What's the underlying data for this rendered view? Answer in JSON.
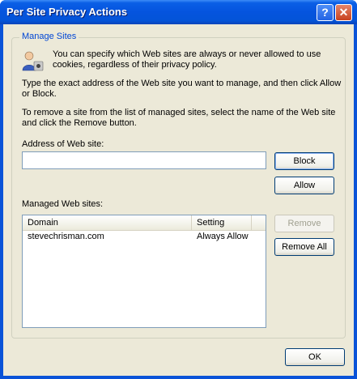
{
  "window": {
    "title": "Per Site Privacy Actions",
    "help_glyph": "?",
    "close_glyph": "✕"
  },
  "group": {
    "label": "Manage Sites"
  },
  "text": {
    "intro_line1": "You can specify which Web sites are always or never allowed to use",
    "intro_line2": "cookies, regardless of their privacy policy.",
    "type_line1": "Type the exact address of the Web site you want to manage, and then click Allow",
    "type_line2": "or Block.",
    "remove_line1": "To remove a site from the list of managed sites, select the name of the Web site",
    "remove_line2": "and click the Remove button.",
    "address_label": "Address of Web site:",
    "managed_label": "Managed Web sites:"
  },
  "address_input": {
    "value": "",
    "placeholder": ""
  },
  "buttons": {
    "block": "Block",
    "allow": "Allow",
    "remove": "Remove",
    "remove_all": "Remove All",
    "ok": "OK"
  },
  "list": {
    "columns": [
      "Domain",
      "Setting"
    ],
    "rows": [
      {
        "domain": "stevechrisman.com",
        "setting": "Always Allow"
      }
    ]
  },
  "icon": "privacy-person-icon"
}
